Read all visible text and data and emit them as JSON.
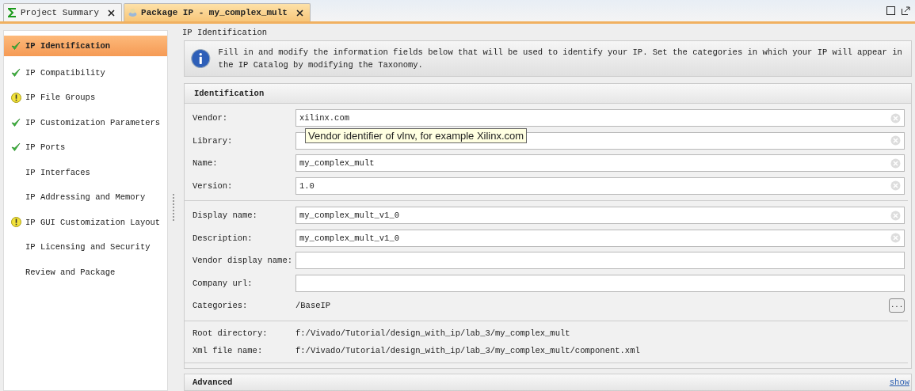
{
  "tabs": [
    {
      "label": "Project Summary",
      "selected": false
    },
    {
      "label": "Package IP - my_complex_mult",
      "selected": true
    }
  ],
  "sidebar": {
    "items": [
      {
        "label": "IP Identification",
        "kind": "done",
        "selected": true
      },
      {
        "label": "IP Compatibility",
        "kind": "done",
        "selected": false
      },
      {
        "label": "IP File Groups",
        "kind": "warning",
        "selected": false
      },
      {
        "label": "IP Customization Parameters",
        "kind": "done",
        "selected": false
      },
      {
        "label": "IP Ports",
        "kind": "done",
        "selected": false
      },
      {
        "label": "IP Interfaces",
        "kind": "plain",
        "selected": false
      },
      {
        "label": "IP Addressing and Memory",
        "kind": "plain",
        "selected": false
      },
      {
        "label": "IP GUI Customization Layout",
        "kind": "warning",
        "selected": false
      },
      {
        "label": "IP Licensing and Security",
        "kind": "plain",
        "selected": false
      },
      {
        "label": "Review and Package",
        "kind": "plain",
        "selected": false
      }
    ]
  },
  "page": {
    "title": "IP Identification",
    "info": "Fill in and modify the information fields below that will be used to identify your IP. Set the categories in which your IP will appear in the IP Catalog by modifying the Taxonomy.",
    "section": "Identification",
    "groups": [
      [
        {
          "label": "Vendor:",
          "kind": "input",
          "value": "xilinx.com",
          "clearable": true
        },
        {
          "label": "Library:",
          "kind": "input",
          "clearable": true
        },
        {
          "label": "Name:",
          "kind": "input",
          "value": "my_complex_mult",
          "clearable": true
        },
        {
          "label": "Version:",
          "kind": "input",
          "value": "1.0",
          "clearable": true
        }
      ],
      [
        {
          "label": "Display name:",
          "kind": "input",
          "value": "my_complex_mult_v1_0",
          "clearable": true
        },
        {
          "label": "Description:",
          "kind": "input",
          "value": "my_complex_mult_v1_0",
          "clearable": true
        },
        {
          "label": "Vendor display name:",
          "kind": "input",
          "clearable": false
        },
        {
          "label": "Company url:",
          "kind": "input",
          "clearable": false
        },
        {
          "label": "Categories:",
          "kind": "browse",
          "value": "/BaseIP",
          "button": "..."
        }
      ],
      [
        {
          "label": "Root directory:",
          "kind": "text",
          "value": "f:/Vivado/Tutorial/design_with_ip/lab_3/my_complex_mult"
        },
        {
          "label": "Xml file name:",
          "kind": "text",
          "value": "f:/Vivado/Tutorial/design_with_ip/lab_3/my_complex_mult/component.xml"
        }
      ]
    ],
    "tooltip": "Vendor identifier of vlnv, for example Xilinx.com",
    "advanced": {
      "title": "Advanced",
      "link": "show"
    }
  }
}
